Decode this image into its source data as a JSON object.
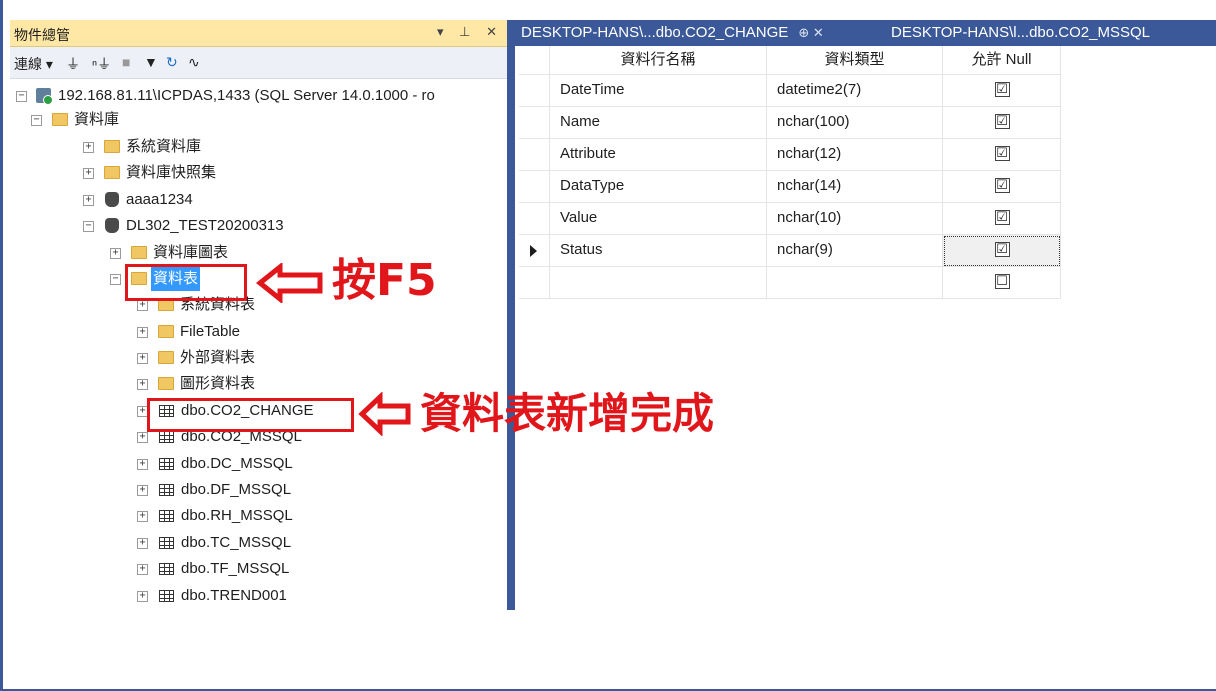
{
  "object_explorer": {
    "title": "物件總管",
    "title_buttons": "▾ ⊥ ✕",
    "toolbar": {
      "connect_label": "連線 ▾",
      "icons": [
        "connect-plug-icon",
        "disconnect-icon",
        "stop-icon",
        "filter-icon",
        "refresh-icon",
        "activity-monitor-icon"
      ]
    },
    "tree": {
      "server": "192.168.81.11\\ICPDAS,1433 (SQL Server 14.0.1000 - ro",
      "databases_folder": "資料庫",
      "system_databases": "系統資料庫",
      "database_snapshots": "資料庫快照集",
      "db1": "aaaa1234",
      "db2": "DL302_TEST20200313",
      "db_diagrams": "資料庫圖表",
      "tables_folder": "資料表",
      "system_tables": "系統資料表",
      "file_table": "FileTable",
      "external_tables": "外部資料表",
      "graph_tables": "圖形資料表",
      "tables": [
        "dbo.CO2_CHANGE",
        "dbo.CO2_MSSQL",
        "dbo.DC_MSSQL",
        "dbo.DF_MSSQL",
        "dbo.RH_MSSQL",
        "dbo.TC_MSSQL",
        "dbo.TF_MSSQL",
        "dbo.TREND001"
      ]
    }
  },
  "tabs": [
    {
      "label": "DESKTOP-HANS\\...dbo.CO2_CHANGE",
      "pin": "⊕ ✕",
      "active": true
    },
    {
      "label": "DESKTOP-HANS\\l...dbo.CO2_MSSQL",
      "active": false
    }
  ],
  "designer": {
    "headers": [
      "資料行名稱",
      "資料類型",
      "允許 Null"
    ],
    "rows": [
      {
        "name": "DateTime",
        "type": "datetime2(7)",
        "allow_null": "☑"
      },
      {
        "name": "Name",
        "type": "nchar(100)",
        "allow_null": "☑"
      },
      {
        "name": "Attribute",
        "type": "nchar(12)",
        "allow_null": "☑"
      },
      {
        "name": "DataType",
        "type": "nchar(14)",
        "allow_null": "☑"
      },
      {
        "name": "Value",
        "type": "nchar(10)",
        "allow_null": "☑"
      },
      {
        "name": "Status",
        "type": "nchar(9)",
        "allow_null": "☑"
      },
      {
        "name": "",
        "type": "",
        "allow_null": "☐"
      }
    ]
  },
  "annotations": {
    "press_f5": "按F5",
    "table_added": "資料表新增完成"
  },
  "colors": {
    "accent_blue": "#3b5998",
    "title_yellow": "#ffe8a6",
    "annotation_red": "#e0161b",
    "selection_blue": "#3399ff"
  }
}
